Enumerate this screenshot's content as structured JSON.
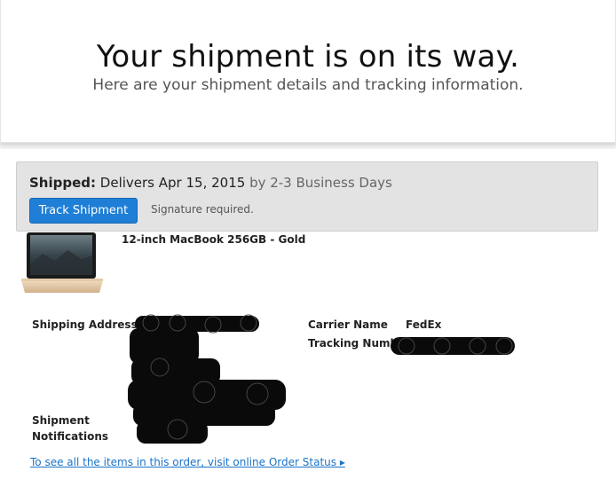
{
  "header": {
    "title": "Your shipment is on its way.",
    "subtitle": "Here are your shipment details and tracking information."
  },
  "status": {
    "label": "Shipped:",
    "delivery": "Delivers Apr 15, 2015",
    "timeframe": "by 2-3 Business Days",
    "track_button": "Track Shipment",
    "signature_note": "Signature required."
  },
  "product": {
    "name": "12-inch MacBook 256GB - Gold",
    "image_icon": "laptop-image"
  },
  "details": {
    "shipping_address_label": "Shipping Address",
    "notifications_label_line1": "Shipment",
    "notifications_label_line2": "Notifications",
    "carrier_label": "Carrier Name",
    "carrier_value": "FedEx",
    "tracking_label": "Tracking Numbe"
  },
  "footer": {
    "order_status_link": "To see all the items in this order, visit online Order Status ▸"
  },
  "colors": {
    "accent_blue": "#1f7fd6",
    "link_blue": "#1a73c8",
    "status_bg": "#e3e3e3"
  }
}
